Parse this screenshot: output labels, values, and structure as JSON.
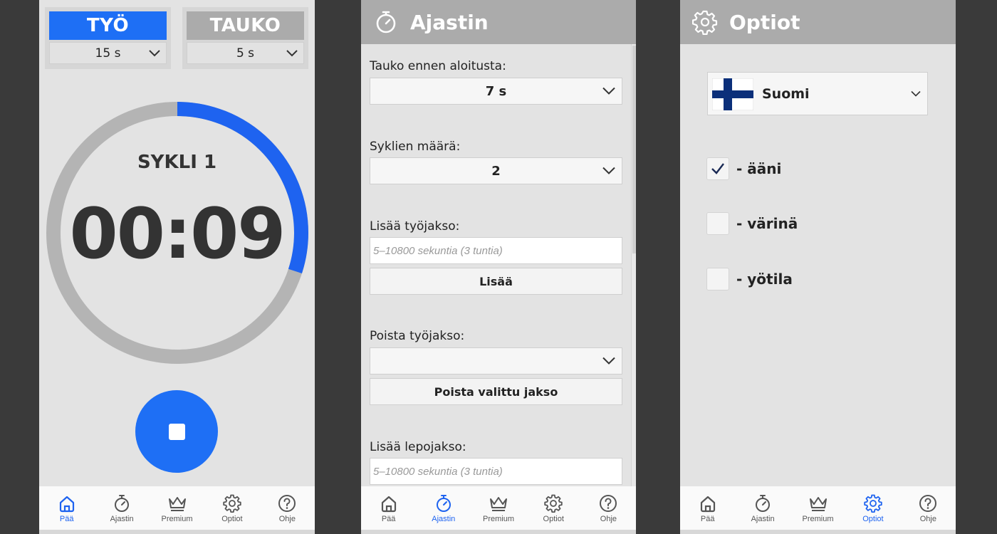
{
  "colors": {
    "accent": "#1e6ff5",
    "nav_active": "#1e63f0",
    "ring_track": "#b4b4b4",
    "ring_progress": "#1e63f0",
    "header_bg": "#ababab"
  },
  "nav": {
    "items": [
      {
        "label": "Pää",
        "icon": "home-icon"
      },
      {
        "label": "Ajastin",
        "icon": "stopwatch-icon"
      },
      {
        "label": "Premium",
        "icon": "crown-icon"
      },
      {
        "label": "Optiot",
        "icon": "gear-icon"
      },
      {
        "label": "Ohje",
        "icon": "help-icon"
      }
    ]
  },
  "main": {
    "work": {
      "title": "TYÖ",
      "value": "15 s",
      "active": true
    },
    "rest": {
      "title": "TAUKO",
      "value": "5 s",
      "active": false
    },
    "cycle_label": "SYKLI 1",
    "time": "00:09",
    "progress_fraction": 0.3,
    "stop_icon": "stop-icon",
    "active_nav": "Pää"
  },
  "timer_settings": {
    "header_title": "Ajastin",
    "header_icon": "stopwatch-icon",
    "pause_before_start": {
      "label": "Tauko ennen aloitusta:",
      "value": "7 s"
    },
    "cycle_count": {
      "label": "Syklien määrä:",
      "value": "2"
    },
    "add_work": {
      "label": "Lisää työjakso:",
      "placeholder": "5–10800 sekuntia (3 tuntia)",
      "button": "Lisää"
    },
    "remove_work": {
      "label": "Poista työjakso:",
      "value": "",
      "button": "Poista valittu jakso"
    },
    "add_rest": {
      "label": "Lisää lepojakso:",
      "placeholder": "5–10800 sekuntia (3 tuntia)"
    },
    "active_nav": "Ajastin"
  },
  "options": {
    "header_title": "Optiot",
    "header_icon": "gear-icon",
    "language": {
      "value": "Suomi",
      "flag": "finland-flag"
    },
    "checks": [
      {
        "label": "- ääni",
        "checked": true
      },
      {
        "label": "- värinä",
        "checked": false
      },
      {
        "label": "- yötila",
        "checked": false
      }
    ],
    "active_nav": "Optiot"
  }
}
